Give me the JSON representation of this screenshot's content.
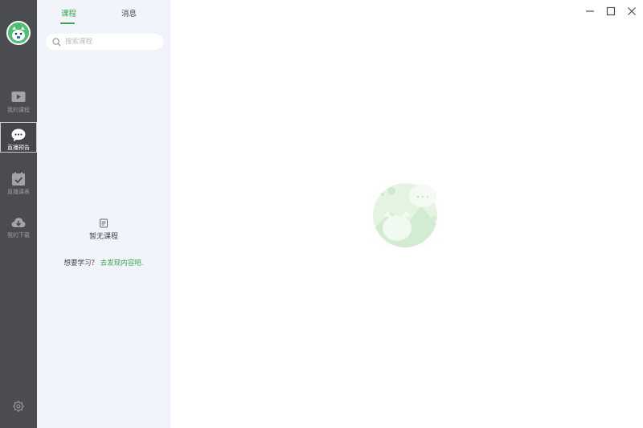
{
  "tabs": {
    "course_label": "课程",
    "message_label": "消息"
  },
  "search": {
    "placeholder": "搜索课程",
    "value": ""
  },
  "rail": {
    "items": [
      {
        "label": "我的课程",
        "icon": "play-icon"
      },
      {
        "label": "直播预告",
        "icon": "chat-bubble-icon",
        "active": true
      },
      {
        "label": "直播课表",
        "icon": "calendar-check-icon"
      },
      {
        "label": "我的下载",
        "icon": "cloud-download-icon"
      }
    ],
    "settings_icon": "gear-icon"
  },
  "empty": {
    "title": "暂无课程",
    "prompt": "想要学习？",
    "link": "去发现内容吧."
  },
  "colors": {
    "accent": "#3aa74a",
    "rail_bg": "#4a4c52",
    "panel_bg": "#f1f4fa"
  }
}
